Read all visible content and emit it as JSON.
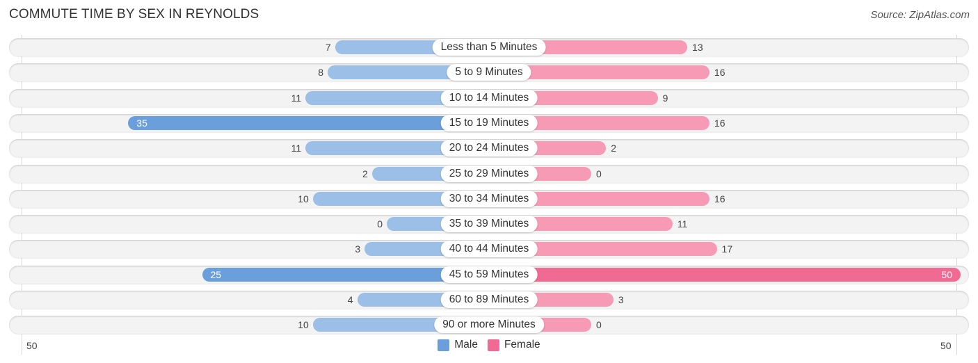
{
  "header": {
    "title": "COMMUTE TIME BY SEX IN REYNOLDS",
    "source": "Source: ZipAtlas.com"
  },
  "colors": {
    "male": "#9bbfe6",
    "male_strong": "#6a9fdb",
    "female": "#f69ab6",
    "female_strong": "#f06a94"
  },
  "chart_data": {
    "type": "bar",
    "orientation": "horizontal-diverging",
    "title": "COMMUTE TIME BY SEX IN REYNOLDS",
    "categories": [
      "Less than 5 Minutes",
      "5 to 9 Minutes",
      "10 to 14 Minutes",
      "15 to 19 Minutes",
      "20 to 24 Minutes",
      "25 to 29 Minutes",
      "30 to 34 Minutes",
      "35 to 39 Minutes",
      "40 to 44 Minutes",
      "45 to 59 Minutes",
      "60 to 89 Minutes",
      "90 or more Minutes"
    ],
    "series": [
      {
        "name": "Male",
        "values": [
          7,
          8,
          11,
          35,
          11,
          2,
          10,
          0,
          3,
          25,
          4,
          10
        ]
      },
      {
        "name": "Female",
        "values": [
          13,
          16,
          9,
          16,
          2,
          0,
          16,
          11,
          17,
          50,
          3,
          0
        ]
      }
    ],
    "axis": {
      "left_label": "50",
      "right_label": "50",
      "max": 50
    },
    "legend": {
      "position": "bottom-center",
      "items": [
        "Male",
        "Female"
      ]
    },
    "grid": false
  }
}
